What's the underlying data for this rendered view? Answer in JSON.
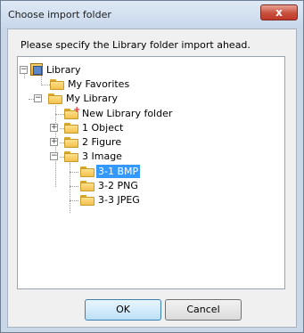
{
  "window": {
    "title": "Choose import folder",
    "close_label": "x"
  },
  "prompt": "Please specify the Library folder import ahead.",
  "tree": {
    "root": "Library",
    "favorites": "My Favorites",
    "my_library": "My Library",
    "new_folder": "New Library folder",
    "object": "1 Object",
    "figure": "2 Figure",
    "image": "3 Image",
    "bmp": "3-1 BMP",
    "png": "3-2 PNG",
    "jpeg": "3-3 JPEG",
    "selected": "3-1 BMP"
  },
  "buttons": {
    "ok": "OK",
    "cancel": "Cancel"
  },
  "colors": {
    "selection": "#3399ff",
    "close_button": "#c7503c",
    "ok_button": "#bde0f7"
  }
}
